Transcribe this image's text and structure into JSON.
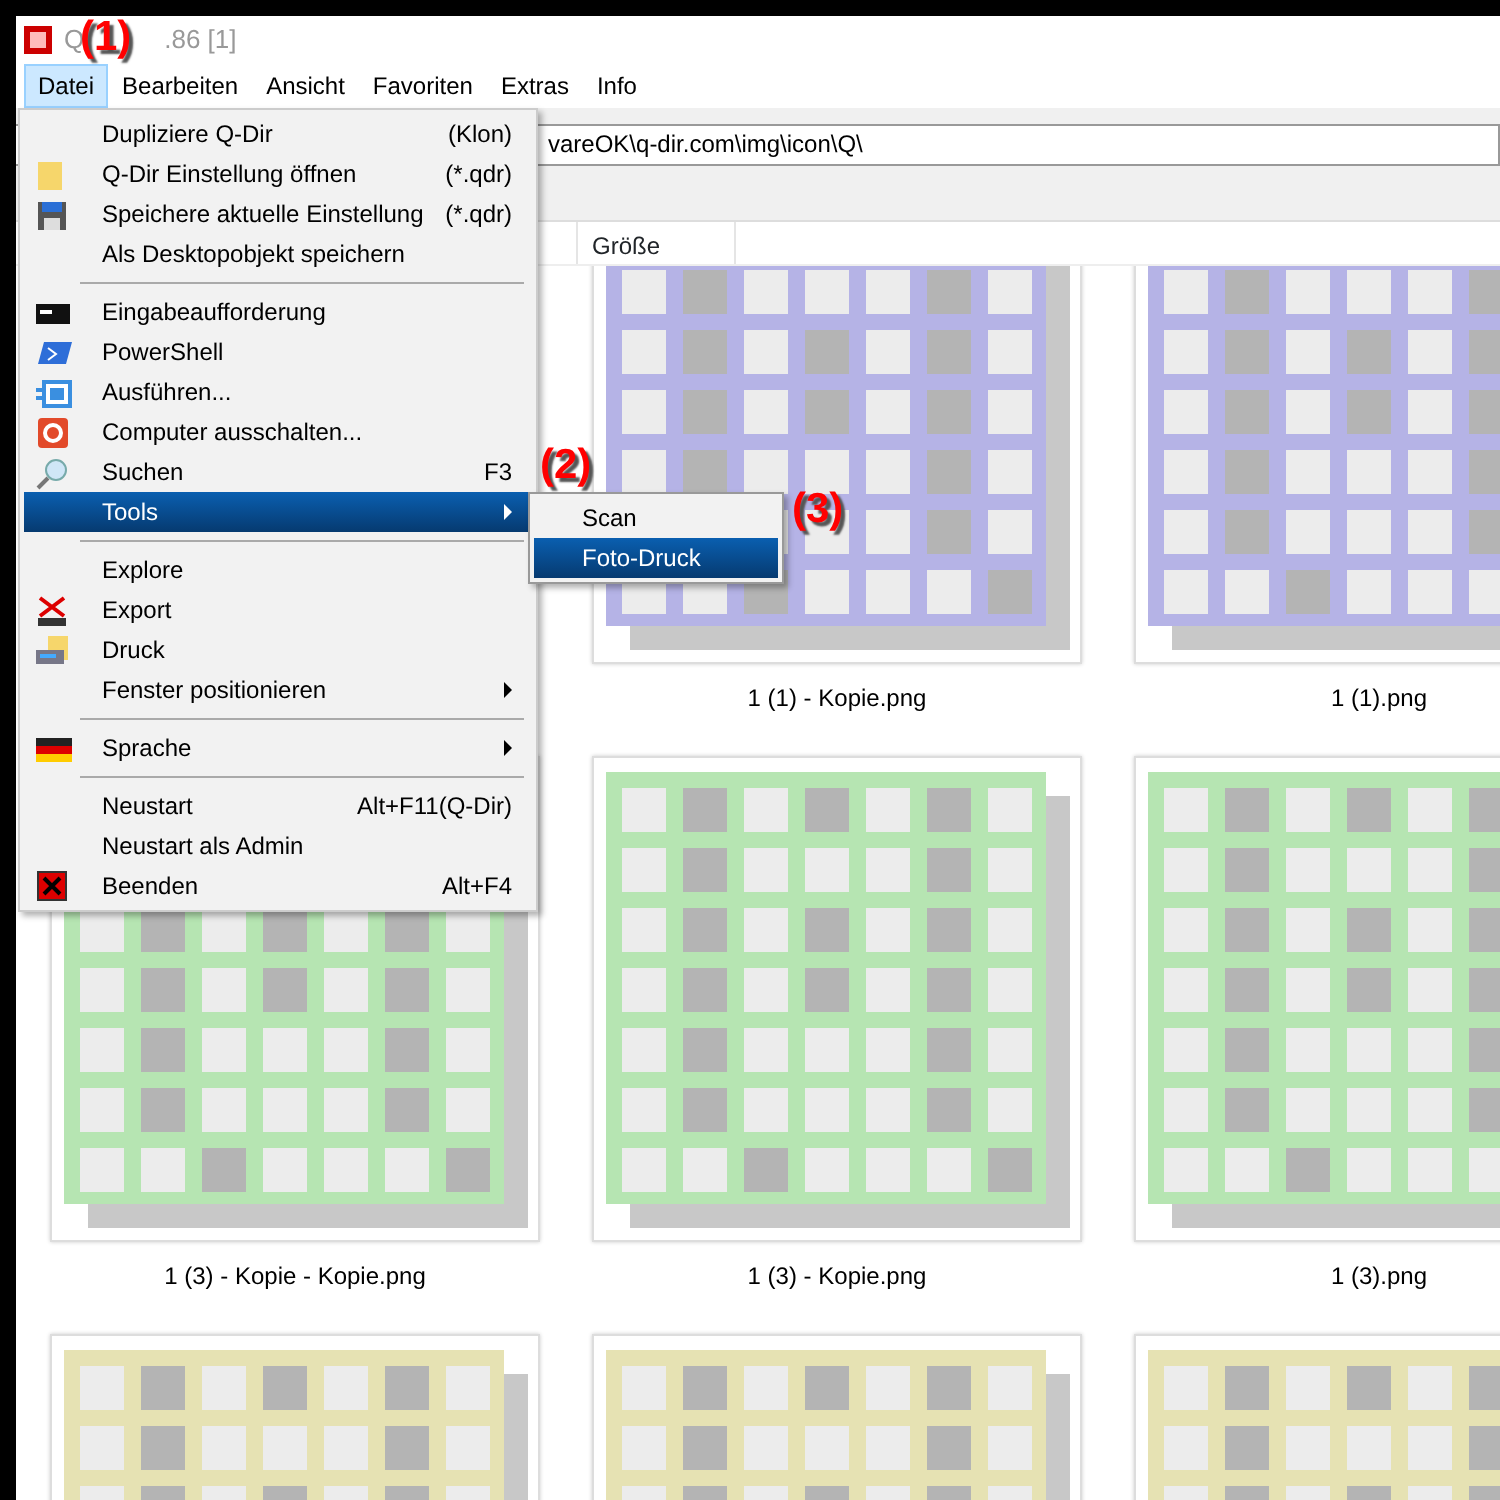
{
  "window": {
    "title_start": "Q",
    "title_end": ".86 [1]"
  },
  "menu_bar": [
    {
      "label": "Datei",
      "selected": true
    },
    {
      "label": "Bearbeiten",
      "selected": false
    },
    {
      "label": "Ansicht",
      "selected": false
    },
    {
      "label": "Favoriten",
      "selected": false
    },
    {
      "label": "Extras",
      "selected": false
    },
    {
      "label": "Info",
      "selected": false
    }
  ],
  "address": "vareOK\\q-dir.com\\img\\icon\\Q\\",
  "columns": [
    "Größe"
  ],
  "files": [
    {
      "label": "1 (1) - Kopie.png",
      "color": "#b5b3e6"
    },
    {
      "label": "1 (1).png",
      "color": "#b5b3e6"
    },
    {
      "label": "1 (3) - Kopie - Kopie.png",
      "color": "#b6e5b2"
    },
    {
      "label": "1 (3) - Kopie.png",
      "color": "#b6e5b2"
    },
    {
      "label": "1 (3).png",
      "color": "#b6e5b2"
    },
    {
      "color": "#e6e2b3"
    },
    {
      "color": "#e6e2b3"
    },
    {
      "color": "#e6e2b3"
    }
  ],
  "file_menu": [
    {
      "kind": "item",
      "label": "Dupliziere Q-Dir",
      "shortcut": "(Klon)",
      "submenu": false,
      "selected": false
    },
    {
      "kind": "item",
      "label": "Q-Dir Einstellung öffnen",
      "shortcut": "(*.qdr)",
      "submenu": false,
      "selected": false
    },
    {
      "kind": "item",
      "label": "Speichere  aktuelle Einstellung",
      "shortcut": "(*.qdr)",
      "submenu": false,
      "selected": false
    },
    {
      "kind": "item",
      "label": "Als Desktopobjekt speichern",
      "submenu": false,
      "selected": false
    },
    {
      "kind": "separator"
    },
    {
      "kind": "item",
      "label": "Eingabeaufforderung",
      "submenu": false,
      "selected": false
    },
    {
      "kind": "item",
      "label": "PowerShell",
      "submenu": false,
      "selected": false
    },
    {
      "kind": "item",
      "label": "Ausführen...",
      "submenu": false,
      "selected": false
    },
    {
      "kind": "item",
      "label": "Computer ausschalten...",
      "submenu": false,
      "selected": false
    },
    {
      "kind": "item",
      "label": "Suchen",
      "shortcut": "F3",
      "submenu": false,
      "selected": false
    },
    {
      "kind": "item",
      "label": "Tools",
      "submenu": true,
      "selected": true
    },
    {
      "kind": "separator"
    },
    {
      "kind": "item",
      "label": "Explore",
      "submenu": false,
      "selected": false
    },
    {
      "kind": "item",
      "label": "Export",
      "submenu": false,
      "selected": false
    },
    {
      "kind": "item",
      "label": "Druck",
      "submenu": false,
      "selected": false
    },
    {
      "kind": "item",
      "label": "Fenster positionieren",
      "submenu": true,
      "selected": false
    },
    {
      "kind": "separator"
    },
    {
      "kind": "item",
      "label": "Sprache",
      "submenu": true,
      "selected": false
    },
    {
      "kind": "separator"
    },
    {
      "kind": "item",
      "label": "Neustart",
      "shortcut": "Alt+F11(Q-Dir)",
      "submenu": false,
      "selected": false
    },
    {
      "kind": "item",
      "label": "Neustart als Admin",
      "submenu": false,
      "selected": false
    },
    {
      "kind": "item",
      "label": "Beenden",
      "shortcut": "Alt+F4",
      "submenu": false,
      "selected": false
    }
  ],
  "submenu": [
    {
      "label": "Scan",
      "selected": false
    },
    {
      "label": "Foto-Druck",
      "selected": true
    }
  ],
  "annotations": [
    "(1)",
    "(2)",
    "(3)"
  ]
}
